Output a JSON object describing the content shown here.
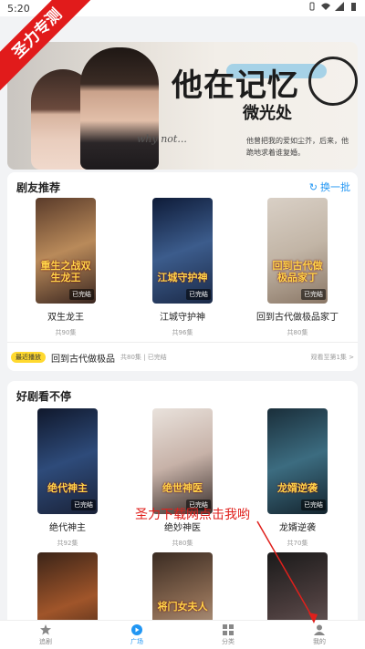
{
  "status_bar": {
    "time": "5:20"
  },
  "watermark": "圣力专测",
  "banner": {
    "title_line1": "他在记忆",
    "title_line2": "微光处",
    "caption": "why not...",
    "subtitle": "他曾把我的爱如尘芥，后来，他跪地求着谁复婚。"
  },
  "section_recommend": {
    "title": "剧友推荐",
    "refresh_label": "换一批",
    "items": [
      {
        "name": "双生龙王",
        "episodes": "共90集",
        "badge": "已完结",
        "poster_text": "重生之战双生龙王",
        "colors": [
          "#5a3b2a",
          "#b98a5a",
          "#3a2620"
        ]
      },
      {
        "name": "江城守护神",
        "episodes": "共96集",
        "badge": "已完结",
        "poster_text": "江城守护神",
        "colors": [
          "#0e1b38",
          "#3c5c8c",
          "#1b2a48"
        ]
      },
      {
        "name": "回到古代做极品家丁",
        "episodes": "共80集",
        "badge": "已完结",
        "poster_text": "回到古代做极品家丁",
        "colors": [
          "#d9d0c6",
          "#c2b5a6",
          "#8a7766"
        ]
      }
    ],
    "recent": {
      "tag": "最近播放",
      "name": "回到古代做极品",
      "info": "共80集 | 已完结",
      "progress": "观看至第1集 >"
    }
  },
  "section_nonstop": {
    "title": "好剧看不停",
    "items": [
      {
        "name": "绝代神主",
        "episodes": "共92集",
        "badge": "已完结",
        "poster_text": "绝代神主",
        "colors": [
          "#10182c",
          "#2e4b7a",
          "#1a2238"
        ]
      },
      {
        "name": "绝妙神医",
        "episodes": "共80集",
        "badge": "已完结",
        "poster_text": "绝世神医",
        "colors": [
          "#e9e2dc",
          "#c7b2a8",
          "#3a2f2c"
        ]
      },
      {
        "name": "龙婿逆袭",
        "episodes": "共70集",
        "badge": "已完结",
        "poster_text": "龙婿逆袭",
        "colors": [
          "#1a2e3a",
          "#3c6c80",
          "#14242e"
        ]
      }
    ],
    "row2": [
      {
        "colors": [
          "#3b2418",
          "#a0552a",
          "#2a1a12"
        ]
      },
      {
        "colors": [
          "#3a2b22",
          "#8a6a52",
          "#cbb7a4"
        ],
        "poster_text": "将门女夫人"
      },
      {
        "colors": [
          "#1a1a1a",
          "#4a3c3c",
          "#7a6a6a"
        ]
      }
    ]
  },
  "overlay_text": "圣力下载网点击我哟",
  "nav": {
    "tabs": [
      {
        "label": "追剧"
      },
      {
        "label": "广场"
      },
      {
        "label": "分类"
      },
      {
        "label": "我的"
      }
    ]
  },
  "accent_color": "#2196f3"
}
